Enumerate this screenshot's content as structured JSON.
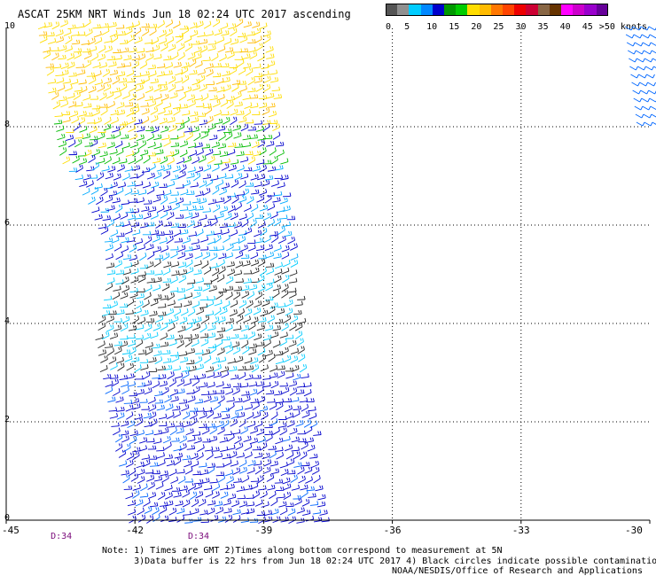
{
  "title": "ASCAT 25KM NRT Winds Jun 18 02:24 UTC 2017 ascending",
  "colorbar": {
    "colors": [
      "#555555",
      "#909090",
      "#00ccff",
      "#0088ff",
      "#0000cc",
      "#009900",
      "#00cc00",
      "#ffdd00",
      "#ffbb00",
      "#ff7700",
      "#ff4400",
      "#ee0000",
      "#cc0033",
      "#886644",
      "#663300",
      "#ff00ff",
      "#cc00cc",
      "#9900cc",
      "#660099"
    ],
    "labels": [
      {
        "value": "0",
        "pos": 0
      },
      {
        "value": "5",
        "pos": 2
      },
      {
        "value": "10",
        "pos": 4
      },
      {
        "value": "15",
        "pos": 6
      },
      {
        "value": "20",
        "pos": 8
      },
      {
        "value": "25",
        "pos": 10
      },
      {
        "value": "30",
        "pos": 12
      },
      {
        "value": "35",
        "pos": 14
      },
      {
        "value": "40",
        "pos": 16
      },
      {
        "value": "45",
        "pos": 18
      },
      {
        "value": ">50 knots",
        "pos": 20
      }
    ]
  },
  "y_axis": {
    "ticks": [
      "0",
      "2",
      "4",
      "6",
      "8",
      "10"
    ],
    "range": [
      0,
      10
    ]
  },
  "x_axis": {
    "ticks": [
      "-45",
      "-42",
      "-39",
      "-36",
      "-33",
      "-30"
    ],
    "range": [
      -45,
      -30
    ]
  },
  "time_labels": [
    {
      "text": "D:34",
      "lon": -43.8
    },
    {
      "text": "D:34",
      "lon": -40.6
    }
  ],
  "notes": {
    "line1": "Note: 1) Times are GMT 2)Times along bottom correspond to measurement at 5N",
    "line2": "      3)Data buffer is 22 hrs from Jun 18 02:24 UTC 2017 4) Black circles indicate possible contamination"
  },
  "credit": "NOAA/NESDIS/Office of Research and Applications"
}
